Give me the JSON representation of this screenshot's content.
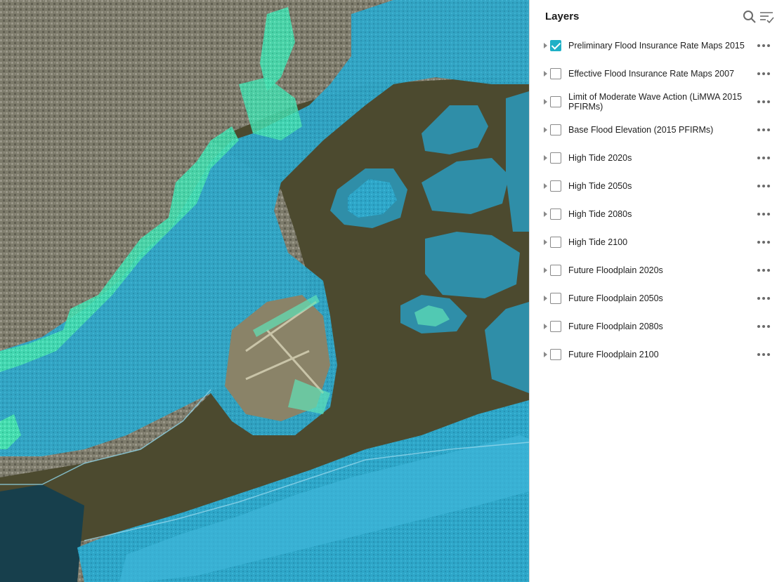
{
  "panel": {
    "title": "Layers",
    "icons": [
      "search-icon",
      "filter-list-icon"
    ]
  },
  "layers": [
    {
      "label": "Preliminary Flood Insurance Rate Maps 2015",
      "checked": true
    },
    {
      "label": "Effective Flood Insurance Rate Maps 2007",
      "checked": false
    },
    {
      "label": "Limit of Moderate Wave Action (LiMWA 2015 PFIRMs)",
      "checked": false
    },
    {
      "label": "Base Flood Elevation (2015 PFIRMs)",
      "checked": false
    },
    {
      "label": "High Tide 2020s",
      "checked": false
    },
    {
      "label": "High Tide 2050s",
      "checked": false
    },
    {
      "label": "High Tide 2080s",
      "checked": false
    },
    {
      "label": "High Tide 2100",
      "checked": false
    },
    {
      "label": "Future Floodplain 2020s",
      "checked": false
    },
    {
      "label": "Future Floodplain 2050s",
      "checked": false
    },
    {
      "label": "Future Floodplain 2080s",
      "checked": false
    },
    {
      "label": "Future Floodplain 2100",
      "checked": false
    }
  ],
  "colors": {
    "urban": "#7b7a6a",
    "flood_zone": "#2aa7c8",
    "flood_zone_dark": "#2a8fa8",
    "surge_green": "#46e0b0",
    "bay_water": "#4d4a30",
    "ocean": "#123e4c",
    "checkbox_accent": "#1fb0c6"
  }
}
